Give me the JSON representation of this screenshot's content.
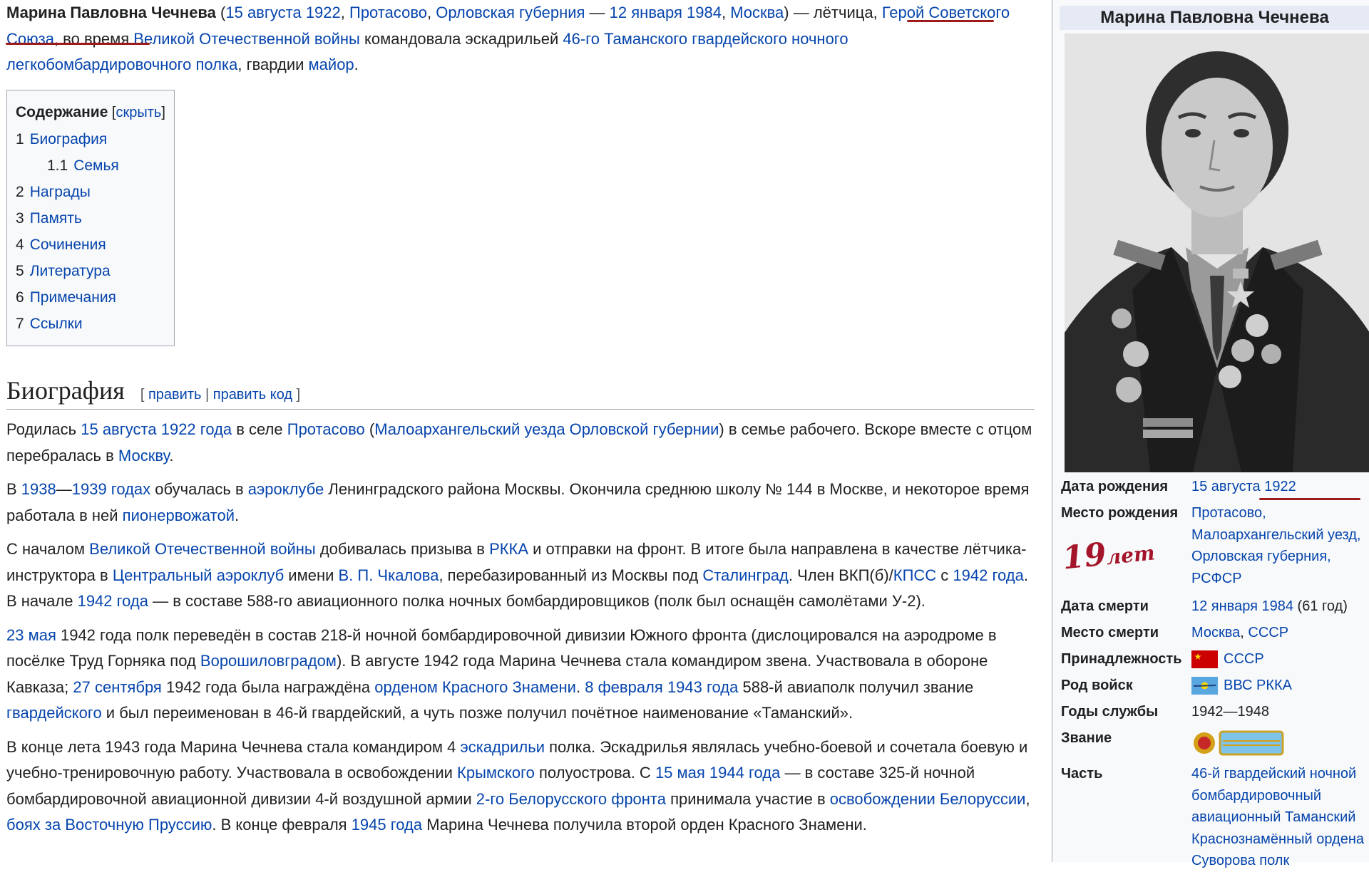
{
  "article": {
    "lead": {
      "subject_bold": "Марина Павловна Чечнева",
      "paren_open": " (",
      "birth_date_link": "15 августа 1922",
      "comma1": ", ",
      "birth_place_link": "Протасово",
      "comma2": ", ",
      "governorate_link": "Орловская губерния",
      "dash": " — ",
      "death_date_link": "12 января 1984",
      "comma3": ", ",
      "death_place_link": "Москва",
      "text1": ") — лётчица, ",
      "hero_link": "Герой Советского Союза",
      "text2": ", во время ",
      "war_link": "Великой Отечественной войны",
      "text3": " командовала эскадрильей ",
      "regiment_link": "46-го Таманского гвардейского ночного легкобомбардировочного полка",
      "text4": ", гвардии ",
      "major_link": "майор",
      "text5": "."
    },
    "toc": {
      "title": "Содержание",
      "toggle_open": " [",
      "toggle": "скрыть",
      "toggle_close": "]",
      "items": [
        {
          "num": "1",
          "label": "Биография"
        },
        {
          "num": "1.1",
          "label": "Семья"
        },
        {
          "num": "2",
          "label": "Награды"
        },
        {
          "num": "3",
          "label": "Память"
        },
        {
          "num": "4",
          "label": "Сочинения"
        },
        {
          "num": "5",
          "label": "Литература"
        },
        {
          "num": "6",
          "label": "Примечания"
        },
        {
          "num": "7",
          "label": "Ссылки"
        }
      ]
    },
    "section": {
      "title": "Биография",
      "edit_open": "[ ",
      "edit": "править",
      "sep": " | ",
      "edit_code": "править код",
      "edit_close": " ]"
    },
    "paragraphs": {
      "p1": {
        "t1": "Родилась ",
        "l1": "15 августа",
        "t2": " ",
        "l2": "1922 года",
        "t3": " в селе ",
        "l3": "Протасово",
        "t4": " (",
        "l4": "Малоархангельский уезда Орловской губернии",
        "t5": ") в семье рабочего. Вскоре вместе с отцом перебралась в ",
        "l5": "Москву",
        "t6": "."
      },
      "p2": {
        "t1": "В ",
        "l1": "1938",
        "t2": "—",
        "l2": "1939 годах",
        "t3": " обучалась в ",
        "l3": "аэроклубе",
        "t4": " Ленинградского района Москвы. Окончила среднюю школу № 144 в Москве, и некоторое время работала в ней ",
        "l4": "пионервожатой",
        "t5": "."
      },
      "p3": {
        "t1": "С началом ",
        "l1": "Великой Отечественной войны",
        "t2": " добивалась призыва в ",
        "l2": "РККА",
        "t3": " и отправки на фронт. В итоге была направлена в качестве лётчика-инструктора в ",
        "l3": "Центральный аэроклуб",
        "t4": " имени ",
        "l4": "В. П. Чкалова",
        "t5": ", перебазированный из Москвы под ",
        "l5": "Сталинград",
        "t6": ". Член ВКП(б)/",
        "l6": "КПСС",
        "t7": " с ",
        "l7": "1942 года",
        "t8": ". В начале ",
        "l8": "1942 года",
        "t9": " — в составе 588-го авиационного полка ночных бомбардировщиков (полк был оснащён самолётами У-2)."
      },
      "p4": {
        "l1": "23 мая",
        "t1": " 1942 года полк переведён в состав 218-й ночной бомбардировочной дивизии Южного фронта (дислоцировался на аэродроме в посёлке Труд Горняка под ",
        "l2": "Ворошиловградом",
        "t2": "). В августе 1942 года Марина Чечнева стала командиром звена. Участвовала в обороне Кавказа; ",
        "l3": "27 сентября",
        "t3": " 1942 года была награждёна ",
        "l4": "орденом Красного Знамени",
        "t4": ". ",
        "l5": "8 февраля",
        "t5": " ",
        "l6": "1943 года",
        "t6": " 588-й авиаполк получил звание ",
        "l7": "гвардейского",
        "t7": " и был переименован в 46-й гвардейский, а чуть позже получил почётное наименование «Таманский»."
      },
      "p5": {
        "t1": "В конце лета 1943 года Марина Чечнева стала командиром 4 ",
        "l1": "эскадрильи",
        "t2": " полка. Эскадрилья являлась учебно-боевой и сочетала боевую и учебно-тренировочную работу. Участвовала в освобождении ",
        "l2": "Крымского",
        "t3": " полуострова. С ",
        "l3": "15 мая",
        "t4": " ",
        "l4": "1944 года",
        "t5": " — в составе 325-й ночной бомбардировочной авиационной дивизии 4-й воздушной армии ",
        "l5": "2-го Белорусского фронта",
        "t6": " принимала участие в ",
        "l6": "освобождении Белоруссии",
        "t7": ", ",
        "l7": "боях за Восточную Пруссию",
        "t8": ". В конце февраля ",
        "l8": "1945 года",
        "t9": " Марина Чечнева получила второй орден Красного Знамени."
      }
    }
  },
  "infobox": {
    "title": "Марина Павловна Чечнева",
    "rows": {
      "birth_date": {
        "label": "Дата рождения",
        "v1": "15 августа",
        "v2": " ",
        "v3": "1922"
      },
      "birth_place": {
        "label": "Место рождения",
        "v1": "Протасово,",
        "v2": "Малоархангельский уезд,",
        "v3": "Орловская губерния,",
        "v4": "РСФСР"
      },
      "death_date": {
        "label": "Дата смерти",
        "v1": "12 января 1984",
        "v2": " (61 год)"
      },
      "death_place": {
        "label": "Место смерти",
        "v1": "Москва",
        "v2": ", ",
        "v3": "СССР"
      },
      "allegiance": {
        "label": "Принадлежность",
        "v1": "СССР"
      },
      "branch": {
        "label": "Род войск",
        "v1": "ВВС РККА"
      },
      "service_years": {
        "label": "Годы службы",
        "v1": "1942—1948"
      },
      "rank": {
        "label": "Звание"
      },
      "unit": {
        "label": "Часть",
        "v1": "46-й гвардейский ночной бомбардировочный авиационный Таманский Краснознамённый ордена Суворова полк"
      }
    }
  },
  "annotation": {
    "handwritten_num": "19",
    "handwritten_word": "лет"
  },
  "colors": {
    "link": "#0645ad",
    "text": "#202122",
    "annotation_red": "#a4152b",
    "infobox_title_bg": "#e6eaf5"
  }
}
